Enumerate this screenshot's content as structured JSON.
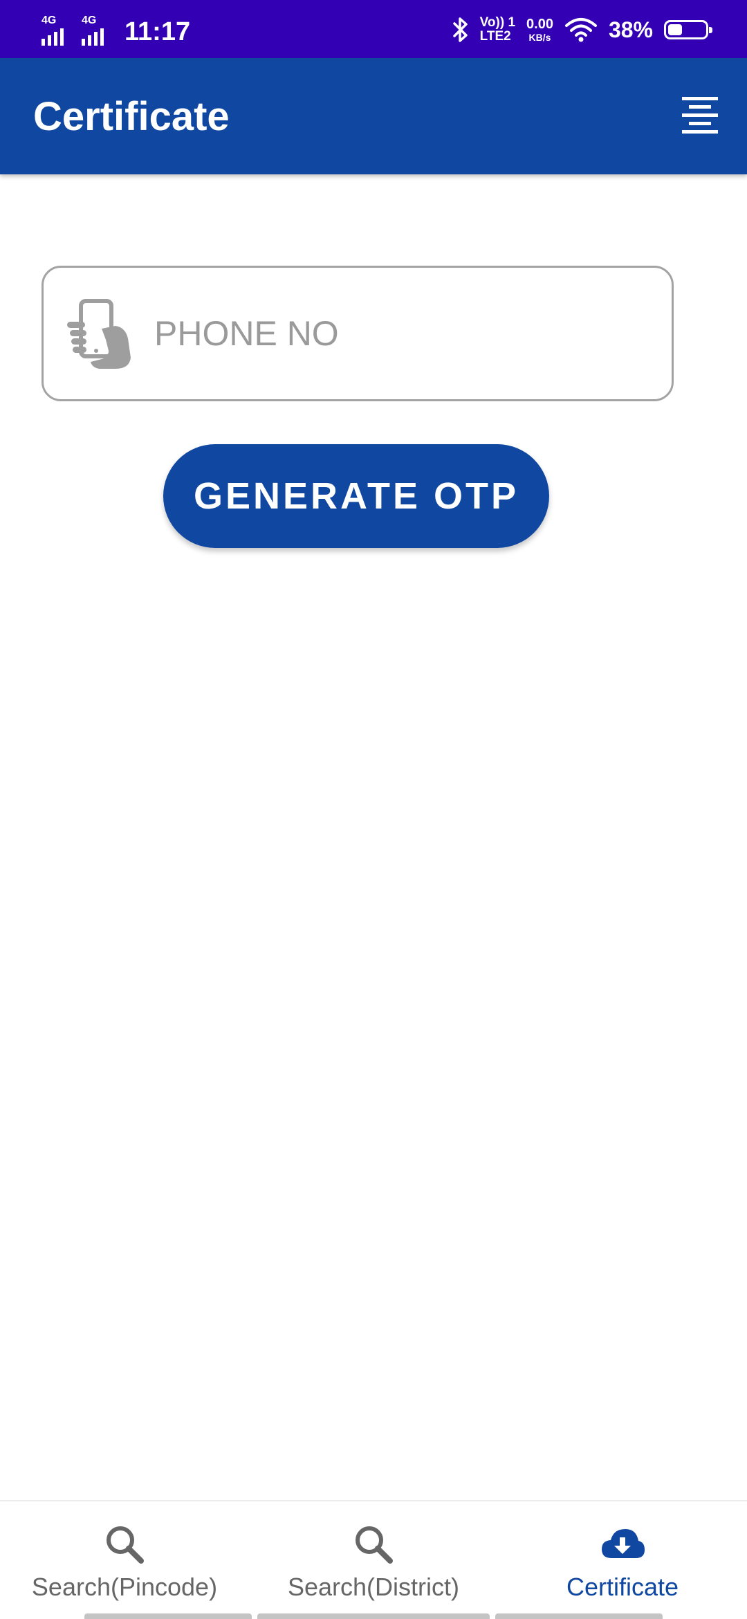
{
  "status_bar": {
    "sim1_network": "4G",
    "sim2_network": "4G",
    "time": "11:17",
    "volte_line1": "Vo)) 1",
    "volte_line2": "LTE2",
    "speed_value": "0.00",
    "speed_unit": "KB/s",
    "battery_percent": "38%",
    "battery_level": 0.38,
    "icons": [
      "signal-icon",
      "bluetooth-icon",
      "wifi-icon",
      "battery-icon"
    ]
  },
  "app_bar": {
    "title": "Certificate",
    "menu_icon": "menu-icon"
  },
  "form": {
    "phone_placeholder": "PHONE NO",
    "phone_value": "",
    "phone_icon": "phone-in-hand-icon",
    "generate_button_label": "GENERATE OTP"
  },
  "bottom_nav": {
    "items": [
      {
        "label": "Search(Pincode)",
        "icon": "search-icon",
        "active": false
      },
      {
        "label": "Search(District)",
        "icon": "search-icon",
        "active": false
      },
      {
        "label": "Certificate",
        "icon": "cloud-download-icon",
        "active": true
      }
    ]
  },
  "colors": {
    "status_bar": "#3300b4",
    "primary": "#0f47a1",
    "inactive_text": "#666666",
    "field_border": "#a3a3a3",
    "placeholder": "#9a9a9a"
  }
}
